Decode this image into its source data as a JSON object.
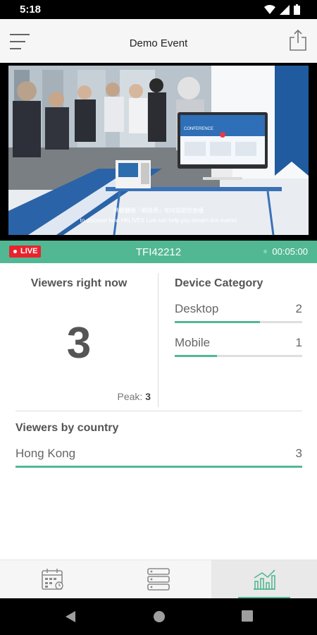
{
  "status_bar": {
    "time": "5:18"
  },
  "app_bar": {
    "title": "Demo Event"
  },
  "video": {
    "caption_line1": "共鍵體驗『網路秀』如何協助您直播",
    "caption_line2": "to discover how HKLIVES Live can help you stream live events",
    "screen_heading": "CONFERENCE"
  },
  "status_strip": {
    "live_label": "LIVE",
    "event_code": "TFI42212",
    "timer": "00:05:00"
  },
  "viewers_now": {
    "label": "Viewers right now",
    "count": "3",
    "peak_label": "Peak:",
    "peak_value": "3"
  },
  "device_category": {
    "label": "Device Category",
    "items": [
      {
        "name": "Desktop",
        "value": "2",
        "share": 0.67
      },
      {
        "name": "Mobile",
        "value": "1",
        "share": 0.33
      }
    ]
  },
  "viewers_by_country": {
    "label": "Viewers by country",
    "items": [
      {
        "name": "Hong Kong",
        "value": "3",
        "share": 1.0
      }
    ]
  },
  "tabs": [
    {
      "name": "schedule",
      "icon": "calendar-icon",
      "active": false
    },
    {
      "name": "list",
      "icon": "list-icon",
      "active": false
    },
    {
      "name": "analytics",
      "icon": "chart-icon",
      "active": true
    }
  ],
  "colors": {
    "accent": "#52b893",
    "live": "#e8232e"
  }
}
